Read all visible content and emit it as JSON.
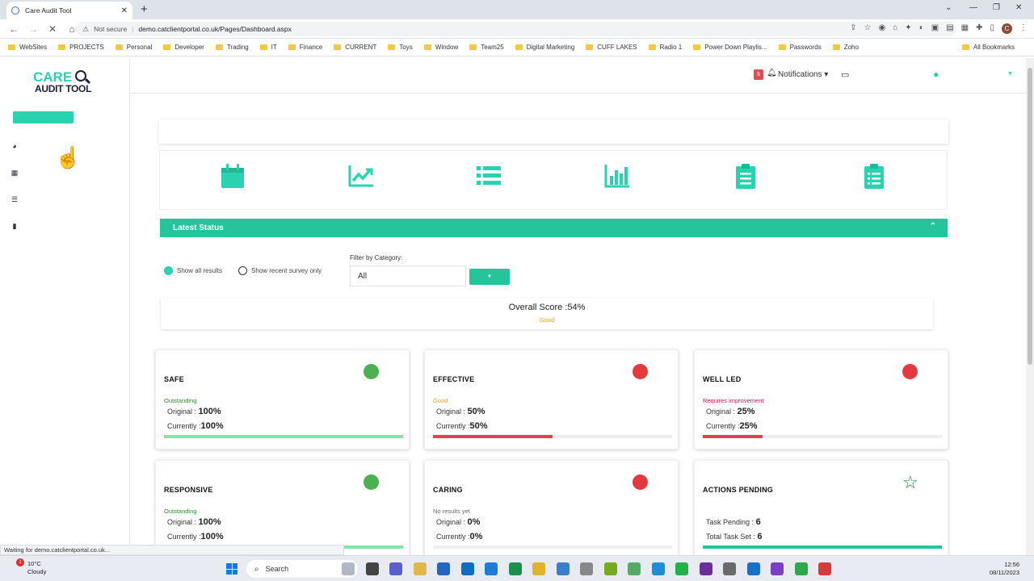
{
  "browser": {
    "tab_title": "Care Audit Tool",
    "not_secure": "Not secure",
    "url": "demo.catclientportal.co.uk/Pages/Dashboard.aspx",
    "profile_initial": "C",
    "bookmarks": [
      "WebSites",
      "PROJECTS",
      "Personal",
      "Developer",
      "Trading",
      "IT",
      "Finance",
      "CURRENT",
      "Toys",
      "Window",
      "Team25",
      "Digital Marketing",
      "CUFF LAKES",
      "Radio 1",
      "Power Down Playlis...",
      "Passwords",
      "Zoho"
    ],
    "all_bookmarks": "All Bookmarks",
    "loading_status": "Waiting for demo.catclientportal.co.uk..."
  },
  "app": {
    "logo_top": "CARE",
    "logo_bottom": "AUDIT TOOL",
    "notifications_count": "6",
    "notifications_label": "Notifications",
    "latest_status": "Latest Status",
    "show_all": "Show all results",
    "show_recent": "Show recent survey only",
    "filter_label": "Filter by Category:",
    "filter_value": "All",
    "overall_score": "Overall Score :54%",
    "overall_grade": "Good"
  },
  "cards": [
    {
      "title": "SAFE",
      "rating": "Outstanding",
      "original_label": "Original :",
      "original": "100%",
      "current_label": "Currently :",
      "current": "100%",
      "progress": 100,
      "indicator": "#4caf50",
      "rating_color": "#2e8b2e",
      "bar_color": "#7be8a8"
    },
    {
      "title": "EFFECTIVE",
      "rating": "Good",
      "original_label": "Original :",
      "original": "50%",
      "current_label": "Currently :",
      "current": "50%",
      "progress": 50,
      "indicator": "#e53940",
      "rating_color": "#e0a52a",
      "bar_color": "#e5404e"
    },
    {
      "title": "WELL LED",
      "rating": "Requires improvement",
      "original_label": "Original :",
      "original": "25%",
      "current_label": "Currently :",
      "current": "25%",
      "progress": 25,
      "indicator": "#e53940",
      "rating_color": "#c2185b",
      "bar_color": "#e5404e"
    },
    {
      "title": "RESPONSIVE",
      "rating": "Outstanding",
      "original_label": "Original :",
      "original": "100%",
      "current_label": "Currently :",
      "current": "100%",
      "progress": 100,
      "indicator": "#4caf50",
      "rating_color": "#2e8b2e",
      "bar_color": "#7be8a8"
    },
    {
      "title": "CARING",
      "rating": "No results yet",
      "original_label": "Original :",
      "original": "0%",
      "current_label": "Currently :",
      "current": "0%",
      "progress": 0,
      "indicator": "#e53940",
      "rating_color": "#666666",
      "bar_color": "#e5404e"
    }
  ],
  "actions": {
    "title": "ACTIONS PENDING",
    "task_pending_label": "Task Pending :",
    "task_pending": "6",
    "total_task_label": "Total Task Set :",
    "total_task": "6",
    "progress": 100
  },
  "taskbar": {
    "temperature": "10°C",
    "weather": "Cloudy",
    "weather_badge": "1",
    "search": "Search",
    "time": "12:56",
    "date": "08/11/2023"
  },
  "colors": {
    "accent": "#2ad3b0",
    "status_bar": "#26c49a"
  }
}
